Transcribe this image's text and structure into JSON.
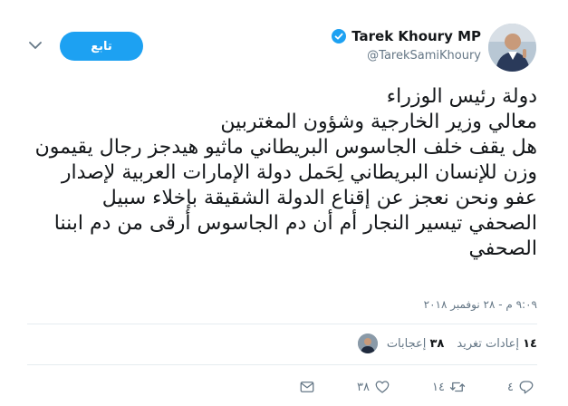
{
  "author": {
    "name": "Tarek Khoury MP",
    "handle": "@TarekSamiKhoury"
  },
  "follow_label": "تابع",
  "tweet_lines": [
    "دولة رئيس الوزراء",
    "معالي وزير الخارجية وشؤون المغتربين",
    "هل يقف خلف الجاسوس البريطاني ماثيو هيدجز رجال يقيمون",
    "وزن للإنسان البريطاني لِحَمل دولة الإمارات العربية لإصدار",
    "عفو ونحن نعجز عن إقناع الدولة الشقيقة بإخلاء سبيل",
    "الصحفي تيسير النجار أم أن دم الجاسوس أرقى من دم ابننا",
    "الصحفي"
  ],
  "timestamp": "٩:٠٩ م - ٢٨ نوفمبر ٢٠١٨",
  "stats": {
    "retweets_count": "١٤",
    "retweets_label": "إعادات تغريد",
    "likes_count": "٣٨",
    "likes_label": "إعجابات"
  },
  "actions": {
    "reply_count": "٤",
    "retweet_count": "١٤",
    "like_count": "٣٨"
  },
  "icons": {
    "verified": "verified-badge-icon",
    "caret": "chevron-down-icon",
    "reply": "reply-icon",
    "retweet": "retweet-icon",
    "like": "heart-icon",
    "message": "envelope-icon"
  },
  "colors": {
    "accent": "#1da1f2",
    "text": "#14171a",
    "muted": "#657786",
    "divider": "#e6ecf0"
  }
}
